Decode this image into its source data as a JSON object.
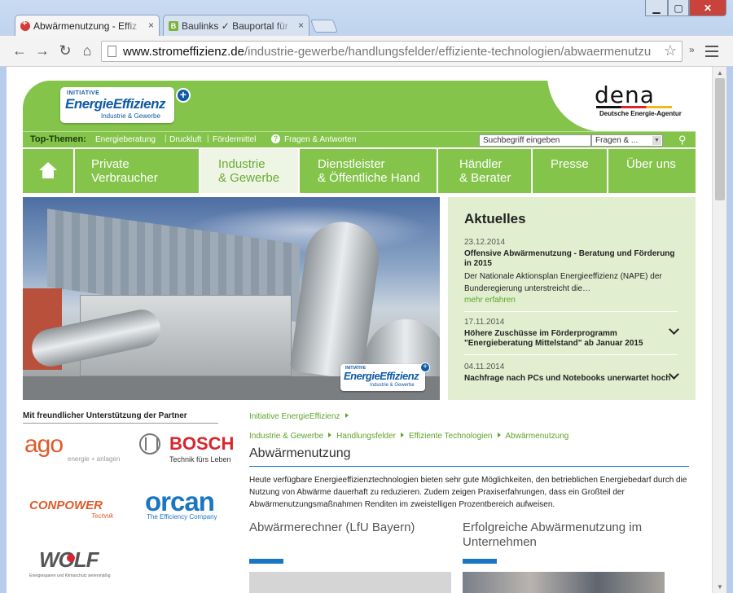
{
  "browser": {
    "tabs": [
      {
        "title": "Abwärmenutzung - Effiz",
        "active": true
      },
      {
        "title": "Baulinks ✓ Bauportal für",
        "active": false
      }
    ],
    "url_host": "www.stromeffizienz.de",
    "url_path": "/industrie-gewerbe/handlungsfelder/effiziente-technologien/abwaermenutzu",
    "close_glyph": "×",
    "min_glyph": "▁",
    "max_glyph": "▢",
    "winclose_glyph": "✕",
    "back_glyph": "←",
    "forward_glyph": "→",
    "reload_glyph": "↻",
    "home_glyph": "⌂",
    "star_glyph": "☆",
    "ext_glyph": "»",
    "fav_b": "B"
  },
  "header": {
    "logo_line1": "INITIATIVE",
    "logo_line2": "EnergieEffizienz",
    "logo_line3": "Industrie & Gewerbe",
    "logo_plus": "+",
    "dena_mark": "dena",
    "dena_sub": "Deutsche Energie-Agentur"
  },
  "topbar": {
    "label": "Top-Themen:",
    "links": [
      "Energieberatung",
      "Druckluft",
      "Fördermittel",
      "Fragen & Antworten"
    ],
    "sep": "|",
    "help_glyph": "?",
    "search_placeholder": "Suchbegriff eingeben",
    "search_scope": "Fragen & ...",
    "caret": "▼",
    "go_glyph": "⚲"
  },
  "nav": {
    "items": [
      {
        "l1": "Private",
        "l2": "Verbraucher"
      },
      {
        "l1": "Industrie",
        "l2": "& Gewerbe"
      },
      {
        "l1": "Dienstleister",
        "l2": "& Öffentliche Hand"
      },
      {
        "l1": "Händler",
        "l2": "& Berater"
      },
      {
        "l1": "Presse",
        "l2": ""
      },
      {
        "l1": "Über uns",
        "l2": ""
      }
    ]
  },
  "hero": {
    "logo_line1": "INITIATIVE",
    "logo_line2": "EnergieEffizienz",
    "logo_line3": "Industrie & Gewerbe",
    "logo_plus": "+"
  },
  "news": {
    "title": "Aktuelles",
    "items": [
      {
        "date": "23.12.2014",
        "head": "Offensive Abwärmenutzung - Beratung und Förderung in 2015",
        "teaser": "Der Nationale Aktionsplan Energieeffizienz (NAPE) der Bunderegierung unterstreicht die…",
        "more": "mehr erfahren"
      },
      {
        "date": "17.11.2014",
        "head": "Höhere Zuschüsse im Förderprogramm \"Energieberatung Mittelstand\" ab Januar 2015"
      },
      {
        "date": "04.11.2014",
        "head": "Nachfrage nach PCs und Notebooks unerwartet hoch"
      }
    ]
  },
  "partners": {
    "title": "Mit freundlicher Unterstützung der Partner",
    "ago": "ago",
    "ago_sub": "energie + anlagen",
    "bosch": "BOSCH",
    "bosch_sub": "Technik fürs Leben",
    "conpower": "CONPOWER",
    "conpower_sub": "Technik",
    "orcan": "orcan",
    "orcan_sub": "The Efficiency Company",
    "wolf": "WOLF",
    "wolf_sub": "Energiesparen und Klimaschutz serienmäßig"
  },
  "content": {
    "crumb_root": "Initiative EnergieEffizienz",
    "crumbs": [
      "Industrie & Gewerbe",
      "Handlungsfelder",
      "Effiziente Technologien",
      "Abwärmenutzung"
    ],
    "title": "Abwärmenutzung",
    "intro": "Heute verfügbare Energieeffizienztechnologien bieten sehr gute Möglichkeiten, den betrieblichen Energiebedarf durch die Nutzung von Abwärme dauerhaft zu reduzieren. Zudem zeigen Praxiserfahrungen, dass ein Großteil der Abwärmenutzungsmaßnahmen Renditen im zweistelligen Prozentbereich aufweisen.",
    "card1_title": "Abwärmerechner (LfU Bayern)",
    "card2_title_l1": "Erfolgreiche Abwärmenutzung im",
    "card2_title_l2": "Unternehmen"
  },
  "colors": {
    "brand_green": "#84c44b",
    "link_green": "#5ea42a",
    "brand_blue": "#1a76c2",
    "news_bg": "#e1efd0"
  }
}
